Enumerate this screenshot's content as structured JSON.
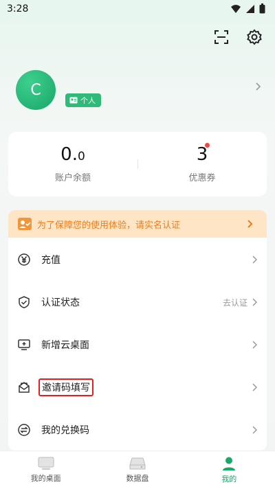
{
  "status": {
    "time": "3:28"
  },
  "profile": {
    "avatar_letter": "C",
    "badge_label": "个人"
  },
  "balance": {
    "amount_int": "0.",
    "amount_dec": "0",
    "amount_label": "账户余额",
    "coupon_count": "3",
    "coupon_label": "优惠券"
  },
  "notice": {
    "text": "为了保障您的使用体验，请实名认证"
  },
  "menu": [
    {
      "label": "充值",
      "icon": "yen-circle-icon"
    },
    {
      "label": "认证状态",
      "icon": "shield-check-icon",
      "sub": "去认证"
    },
    {
      "label": "新增云桌面",
      "icon": "monitor-plus-icon"
    },
    {
      "label": "邀请码填写",
      "icon": "envelope-icon"
    },
    {
      "label": "我的兑换码",
      "icon": "exchange-icon"
    }
  ],
  "bottom_nav": [
    {
      "label": "我的桌面",
      "icon": "desktop-icon"
    },
    {
      "label": "数据盘",
      "icon": "disk-icon"
    },
    {
      "label": "我的",
      "icon": "user-icon",
      "active": true
    }
  ],
  "colors": {
    "accent": "#19a867",
    "notice_bg": "#fde5c5",
    "notice_text": "#ef7d18",
    "highlight": "#e02020"
  }
}
